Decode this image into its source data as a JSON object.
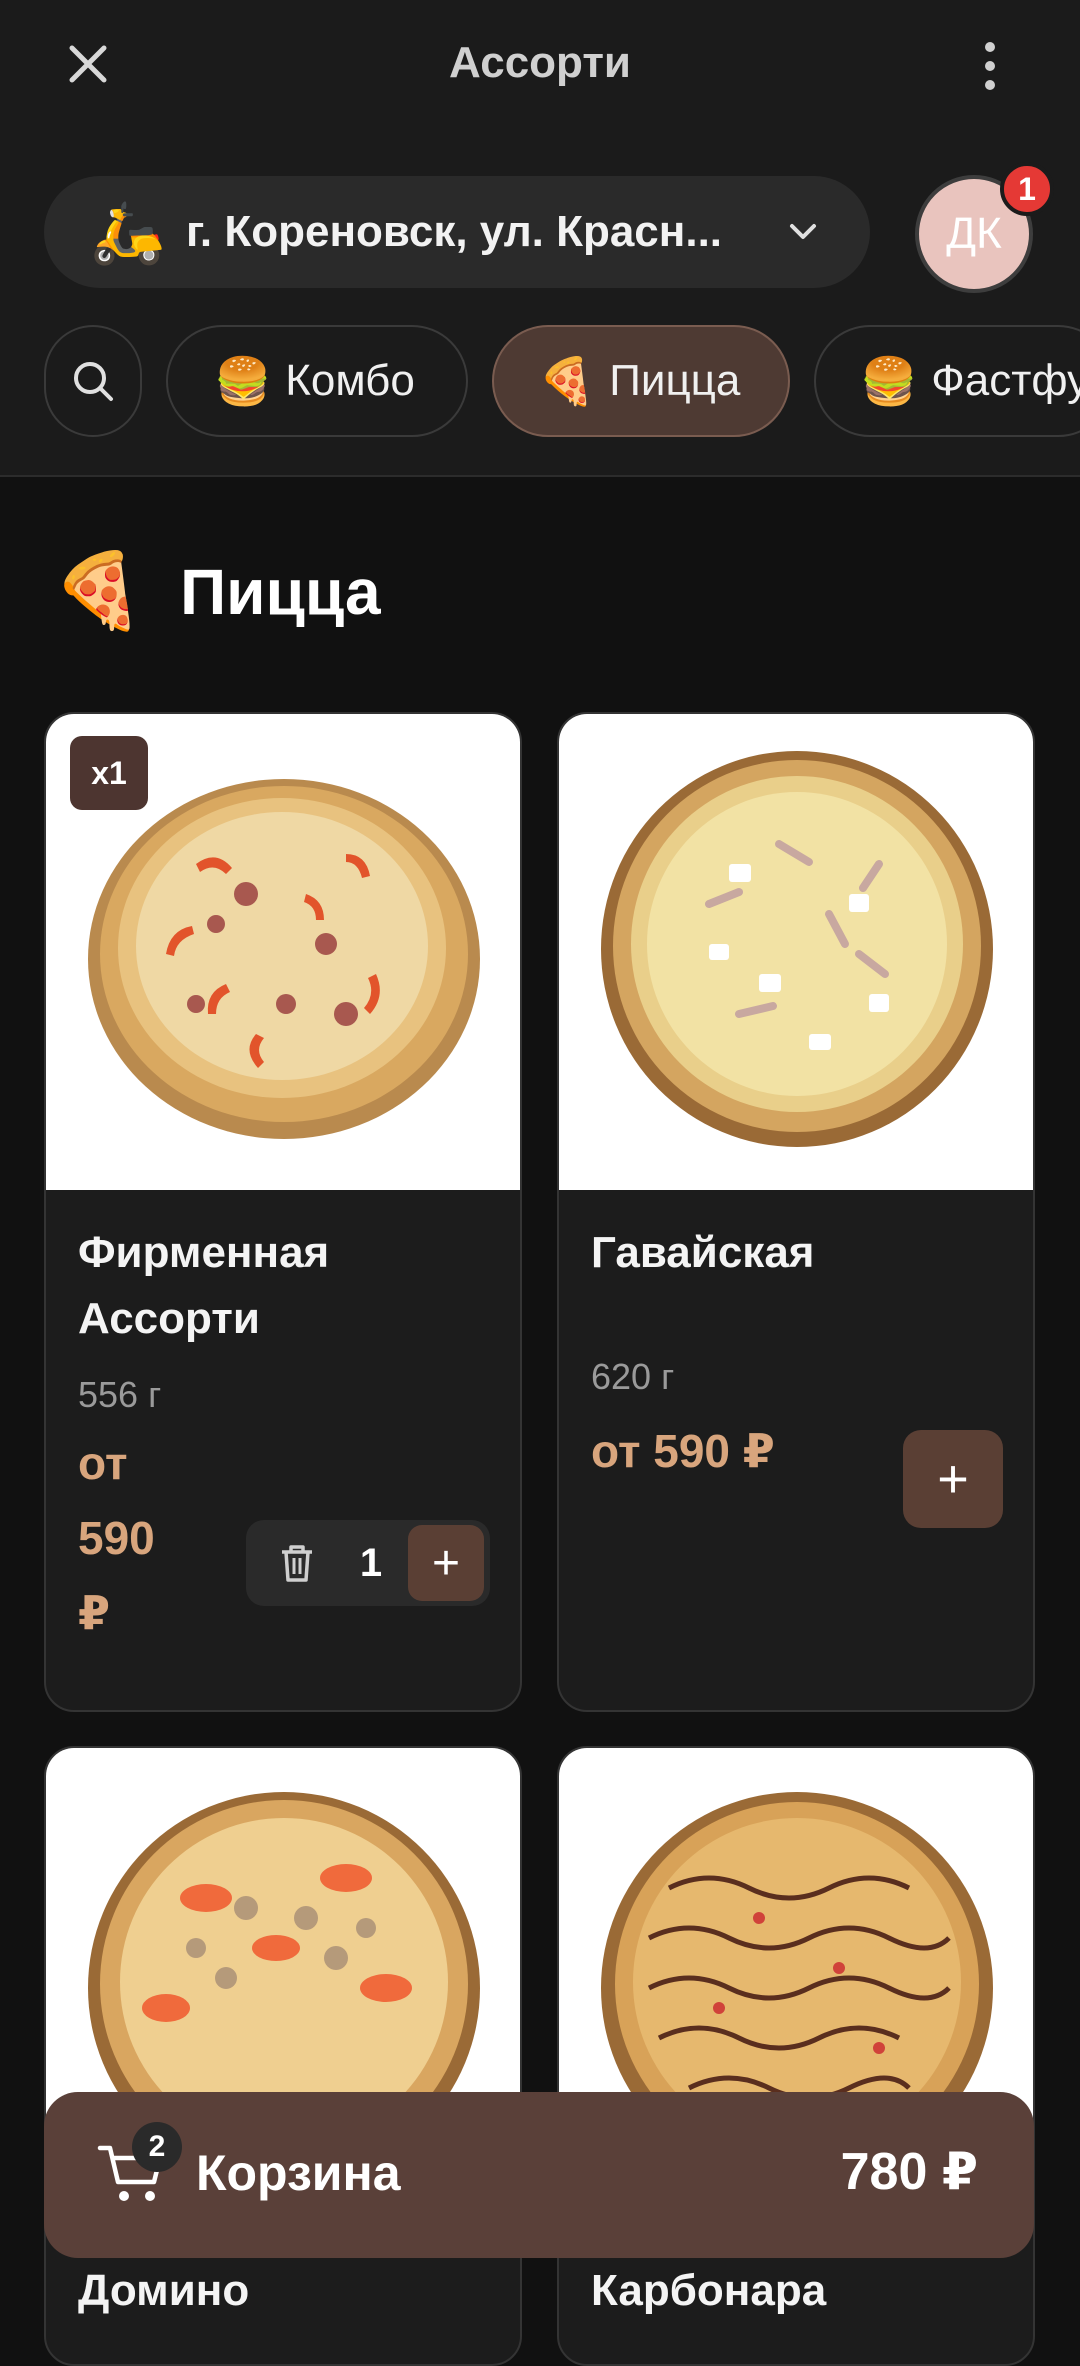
{
  "header": {
    "title": "Ассорти",
    "address": "г. Кореновск, ул. Красн...",
    "address_icon": "scooter-icon",
    "avatar_initials": "ДК",
    "notification_count": "1"
  },
  "categories": [
    {
      "emoji": "🍔",
      "label": "Комбо",
      "active": false
    },
    {
      "emoji": "🍕",
      "label": "Пицца",
      "active": true
    },
    {
      "emoji": "🍔",
      "label": "Фастфуд",
      "active": false
    }
  ],
  "section": {
    "emoji": "🍕",
    "title": "Пицца"
  },
  "products": [
    {
      "name_line1": "Фирменная",
      "name_line2": "Ассорти",
      "weight": "556 г",
      "price_line1": "от",
      "price_line2": "590",
      "price_line3": "₽",
      "in_cart_badge": "x1",
      "quantity": "1"
    },
    {
      "name": "Гавайская",
      "weight": "620 г",
      "price": "от 590 ₽"
    },
    {
      "name": "Домино"
    },
    {
      "name": "Карбонара"
    }
  ],
  "cart": {
    "label": "Корзина",
    "count": "2",
    "total": "780 ₽"
  },
  "colors": {
    "background": "#111111",
    "accent": "#5a3f34",
    "price": "#d8a57d"
  }
}
